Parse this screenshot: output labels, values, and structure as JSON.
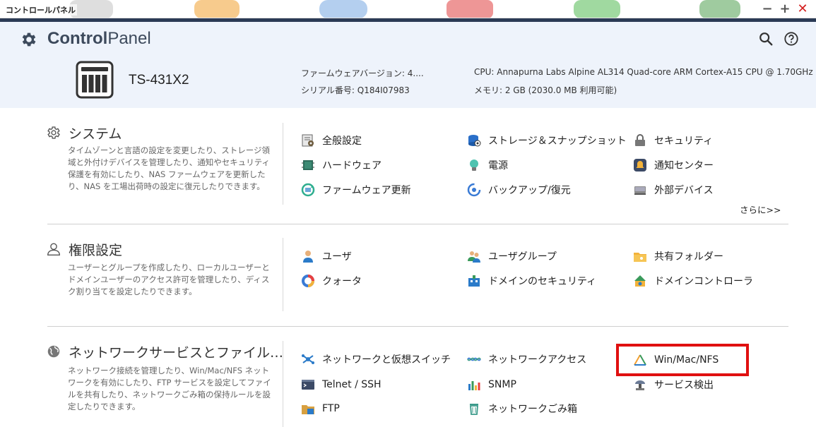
{
  "window": {
    "title": "コントロールパネル",
    "min_glyph": "−",
    "max_glyph": "+",
    "close_glyph": "✕"
  },
  "header": {
    "logo_bold": "Control",
    "logo_regular": "Panel",
    "model": "TS-431X2",
    "firmware_label": "ファームウェアバージョン: ",
    "firmware_value": "4....",
    "serial_label": "シリアル番号: ",
    "serial_value": "Q184I07983",
    "cpu_label": "CPU: ",
    "cpu_value": "Annapurna Labs Alpine AL314 Quad-core ARM Cortex-A15 CPU @ 1.70GHz",
    "memory_label": "メモリ: ",
    "memory_value": "2 GB (2030.0 MB 利用可能)"
  },
  "sections": {
    "system": {
      "title": "システム",
      "description": "タイムゾーンと言語の設定を変更したり、ストレージ領域と外付けデバイスを管理したり、通知やセキュリティ保護を有効にしたり、NAS ファームウェアを更新したり、NAS を工場出荷時の設定に復元したりできます。",
      "items": [
        {
          "label": "全般設定",
          "icon": "general-settings-icon"
        },
        {
          "label": "ストレージ＆スナップショット",
          "icon": "storage-icon"
        },
        {
          "label": "セキュリティ",
          "icon": "lock-icon"
        },
        {
          "label": "ハードウェア",
          "icon": "hardware-icon"
        },
        {
          "label": "電源",
          "icon": "power-bulb-icon"
        },
        {
          "label": "通知センター",
          "icon": "notification-icon"
        },
        {
          "label": "ファームウェア更新",
          "icon": "firmware-update-icon"
        },
        {
          "label": "バックアップ/復元",
          "icon": "backup-icon"
        },
        {
          "label": "外部デバイス",
          "icon": "external-device-icon"
        }
      ],
      "more": "さらに>>"
    },
    "privilege": {
      "title": "権限設定",
      "description": "ユーザーとグループを作成したり、ローカルユーザーとドメインユーザーのアクセス許可を管理したり、ディスク割り当てを設定したりできます。",
      "items": [
        {
          "label": "ユーザ",
          "icon": "user-icon"
        },
        {
          "label": "ユーザグループ",
          "icon": "user-group-icon"
        },
        {
          "label": "共有フォルダー",
          "icon": "shared-folder-icon"
        },
        {
          "label": "クォータ",
          "icon": "quota-icon"
        },
        {
          "label": "ドメインのセキュリティ",
          "icon": "domain-security-icon"
        },
        {
          "label": "ドメインコントローラ",
          "icon": "domain-controller-icon"
        }
      ]
    },
    "network": {
      "title": "ネットワークサービスとファイル…",
      "description": "ネットワーク接続を管理したり、Win/Mac/NFS ネットワークを有効にしたり、FTP サービスを設定してファイルを共有したり、ネットワークごみ箱の保持ルールを設定したりできます。",
      "items": [
        {
          "label": "ネットワークと仮想スイッチ",
          "icon": "network-switch-icon"
        },
        {
          "label": "ネットワークアクセス",
          "icon": "network-access-icon"
        },
        {
          "label": "Win/Mac/NFS",
          "icon": "win-mac-nfs-icon"
        },
        {
          "label": "Telnet / SSH",
          "icon": "terminal-icon"
        },
        {
          "label": "SNMP",
          "icon": "snmp-chart-icon"
        },
        {
          "label": "サービス検出",
          "icon": "service-discovery-icon"
        },
        {
          "label": "FTP",
          "icon": "ftp-icon"
        },
        {
          "label": "ネットワークごみ箱",
          "icon": "recycle-bin-icon"
        }
      ]
    }
  },
  "colors": {
    "header_bg": "#eef3fb",
    "dark_strip": "#2b3a55",
    "highlight": "#e01010",
    "close_red": "#d42020"
  }
}
